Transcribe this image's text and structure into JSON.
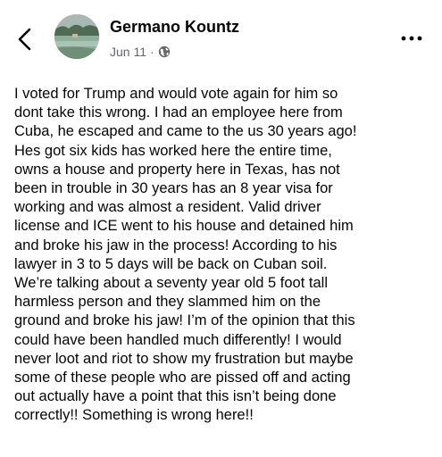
{
  "post": {
    "author": "Germano Kountz",
    "date": "Jun 11",
    "separator": "·",
    "privacy_icon": "globe-icon",
    "text": "I voted for Trump and would vote again for him so\ndont take this wrong. I had an employee here from\nCuba, he escaped and came to the us 30 years ago!\nHes got six kids has worked here the entire time,\nowns a house and property here in Texas, has not\nbeen in trouble in 30 years has an 8 year visa for\nworking and was almost a resident. Valid driver\nlicense and ICE went to his house and detained him\nand broke his jaw in the process! According to his\nlawyer in 3 to 5 days will be back on Cuban soil.\nWe’re talking about a seventy year old 5 foot tall\nharmless person and they slammed him on the\nground and broke his jaw! I’m of the opinion that this\ncould have been handled much differently! I would\nnever loot and riot to show my frustration but maybe\nsome of these people who are pissed off and acting\nout actually have a point that this isn’t being done\ncorrectly!! Something is wrong here!!"
  },
  "icons": {
    "back": "back-chevron-icon",
    "more": "more-options-icon"
  },
  "colors": {
    "text": "#050505",
    "secondary_text": "#65676b",
    "background": "#ffffff"
  }
}
